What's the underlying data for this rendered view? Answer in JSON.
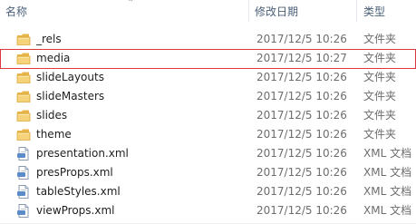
{
  "columns": {
    "name": "名称",
    "modified": "修改日期",
    "type": "类型"
  },
  "rows": [
    {
      "name": "_rels",
      "modified": "2017/12/5 10:26",
      "type": "文件夹",
      "icon": "folder-icon"
    },
    {
      "name": "media",
      "modified": "2017/12/5 10:27",
      "type": "文件夹",
      "icon": "folder-icon"
    },
    {
      "name": "slideLayouts",
      "modified": "2017/12/5 10:26",
      "type": "文件夹",
      "icon": "folder-icon"
    },
    {
      "name": "slideMasters",
      "modified": "2017/12/5 10:26",
      "type": "文件夹",
      "icon": "folder-icon"
    },
    {
      "name": "slides",
      "modified": "2017/12/5 10:26",
      "type": "文件夹",
      "icon": "folder-icon"
    },
    {
      "name": "theme",
      "modified": "2017/12/5 10:26",
      "type": "文件夹",
      "icon": "folder-icon"
    },
    {
      "name": "presentation.xml",
      "modified": "2017/12/5 10:26",
      "type": "XML 文档",
      "icon": "xml-document-icon"
    },
    {
      "name": "presProps.xml",
      "modified": "2017/12/5 10:26",
      "type": "XML 文档",
      "icon": "xml-document-icon"
    },
    {
      "name": "tableStyles.xml",
      "modified": "2017/12/5 10:26",
      "type": "XML 文档",
      "icon": "xml-document-icon"
    },
    {
      "name": "viewProps.xml",
      "modified": "2017/12/5 10:26",
      "type": "XML 文档",
      "icon": "xml-document-icon"
    }
  ],
  "colors": {
    "header_text": "#4c607a",
    "highlight_border": "#e0363e",
    "folder": "#f0c85a"
  }
}
